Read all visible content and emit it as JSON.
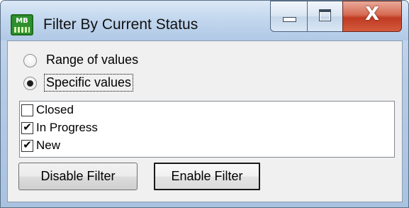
{
  "window": {
    "title": "Filter By Current Status",
    "icon": "app-icon-mb",
    "icon_text": "MB",
    "controls": {
      "close_glyph": "X"
    }
  },
  "mode": {
    "options": [
      {
        "label": "Range of values",
        "selected": false
      },
      {
        "label": "Specific values",
        "selected": true
      }
    ]
  },
  "values_list": {
    "items": [
      {
        "label": "Closed",
        "checked": false
      },
      {
        "label": "In Progress",
        "checked": true
      },
      {
        "label": "New",
        "checked": true
      }
    ]
  },
  "buttons": {
    "disable": "Disable Filter",
    "enable": "Enable Filter"
  },
  "colors": {
    "close_button": "#c03b22",
    "frame": "#b5cce6",
    "client": "#f0f0f0"
  }
}
